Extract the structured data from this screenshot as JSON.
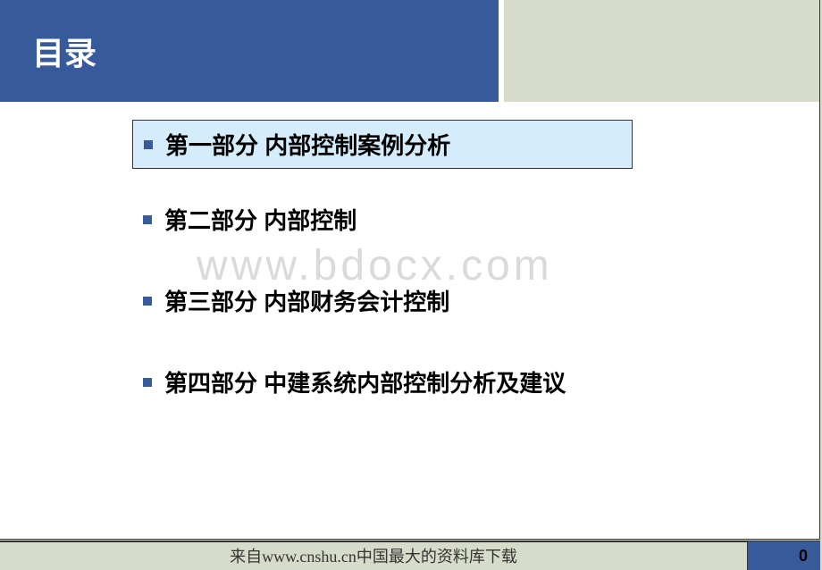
{
  "header": {
    "title": "目录"
  },
  "toc": {
    "items": [
      {
        "label": "第一部分  内部控制案例分析",
        "highlighted": true
      },
      {
        "label": "第二部分  内部控制",
        "highlighted": false
      },
      {
        "label": "第三部分  内部财务会计控制",
        "highlighted": false
      },
      {
        "label": "第四部分  中建系统内部控制分析及建议",
        "highlighted": false
      }
    ]
  },
  "watermark": "www.bdocx.com",
  "footer": {
    "text": "来自www.cnshu.cn中国最大的资料库下载",
    "page": "0"
  }
}
